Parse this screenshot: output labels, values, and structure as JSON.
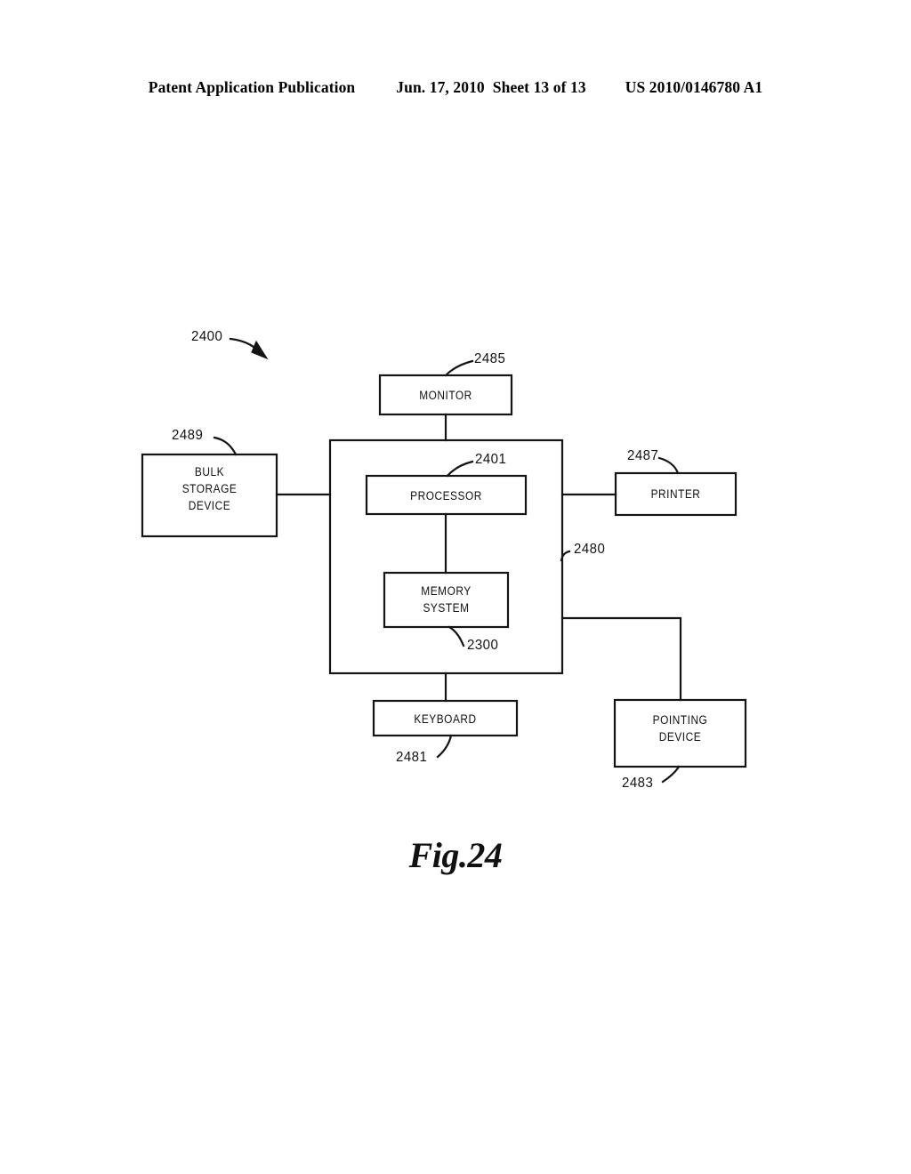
{
  "header": {
    "publication": "Patent Application Publication",
    "date": "Jun. 17, 2010",
    "sheet": "Sheet 13 of 13",
    "document_number": "US 2010/0146780 A1"
  },
  "figure": {
    "caption": "Fig.24",
    "system_reference": "2400",
    "boxes": [
      {
        "id": "monitor",
        "label": "MONITOR",
        "ref": "2485"
      },
      {
        "id": "bulk-storage",
        "label": "BULK\nSTORAGE\nDEVICE",
        "ref": "2489"
      },
      {
        "id": "system-unit",
        "label": "",
        "ref": "2480"
      },
      {
        "id": "processor",
        "label": "PROCESSOR",
        "ref": "2401"
      },
      {
        "id": "memory-system",
        "label": "MEMORY\nSYSTEM",
        "ref": "2300"
      },
      {
        "id": "printer",
        "label": "PRINTER",
        "ref": "2487"
      },
      {
        "id": "keyboard",
        "label": "KEYBOARD",
        "ref": "2481"
      },
      {
        "id": "pointing-device",
        "label": "POINTING\nDEVICE",
        "ref": "2483"
      }
    ],
    "labels": {
      "monitor_line1": "MONITOR",
      "bulk_line1": "BULK",
      "bulk_line2": "STORAGE",
      "bulk_line3": "DEVICE",
      "processor_line1": "PROCESSOR",
      "memory_line1": "MEMORY",
      "memory_line2": "SYSTEM",
      "printer_line1": "PRINTER",
      "keyboard_line1": "KEYBOARD",
      "pointing_line1": "POINTING",
      "pointing_line2": "DEVICE"
    },
    "refs": {
      "system": "2400",
      "monitor": "2485",
      "bulk_storage": "2489",
      "processor": "2401",
      "system_unit": "2480",
      "memory_system": "2300",
      "printer": "2487",
      "keyboard": "2481",
      "pointing_device": "2483"
    },
    "colors": {
      "ink": "#111111",
      "paper": "#ffffff"
    }
  }
}
